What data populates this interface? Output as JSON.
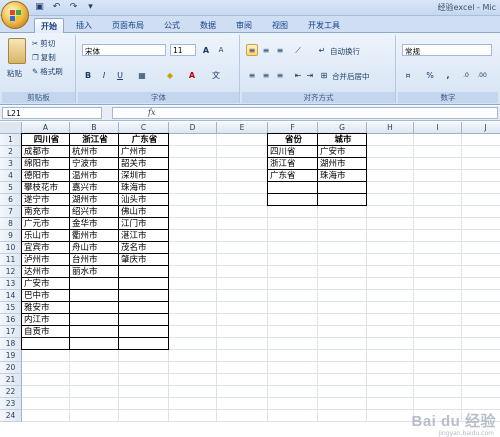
{
  "window": {
    "title": "经验excel - Mic"
  },
  "qat": {
    "icons": [
      "save-icon",
      "undo-icon",
      "redo-icon",
      "customize-icon"
    ],
    "glyphs": [
      "▣",
      "↶",
      "↷",
      "▾"
    ]
  },
  "tabs": [
    "开始",
    "插入",
    "页面布局",
    "公式",
    "数据",
    "审阅",
    "视图",
    "开发工具"
  ],
  "clipboard": {
    "paste": "粘贴",
    "cut": "剪切",
    "copy": "复制",
    "format_painter": "格式刷",
    "label": "剪贴板"
  },
  "font": {
    "name": "宋体",
    "size": "11",
    "grow": "A",
    "shrink": "A",
    "bold": "B",
    "italic": "I",
    "underline": "U",
    "label": "字体"
  },
  "alignment": {
    "wrap": "自动换行",
    "merge": "合并后居中",
    "label": "对齐方式"
  },
  "number": {
    "format": "常规",
    "percent": "%",
    "comma": ",",
    "label": "数字"
  },
  "formula_bar": {
    "name_box": "L21",
    "fx": "fx",
    "formula": ""
  },
  "columns": [
    "A",
    "B",
    "C",
    "D",
    "E",
    "F",
    "G",
    "H",
    "I",
    "J"
  ],
  "rows": [
    "1",
    "2",
    "3",
    "4",
    "5",
    "6",
    "7",
    "8",
    "9",
    "10",
    "11",
    "12",
    "13",
    "14",
    "15",
    "16",
    "17",
    "18",
    "19",
    "20",
    "21",
    "22",
    "23",
    "24"
  ],
  "table1": {
    "headers": [
      "四川省",
      "浙江省",
      "广东省"
    ],
    "rows": [
      [
        "成都市",
        "杭州市",
        "广州市"
      ],
      [
        "绵阳市",
        "宁波市",
        "韶关市"
      ],
      [
        "德阳市",
        "温州市",
        "深圳市"
      ],
      [
        "攀枝花市",
        "嘉兴市",
        "珠海市"
      ],
      [
        "遂宁市",
        "湖州市",
        "汕头市"
      ],
      [
        "南充市",
        "绍兴市",
        "佛山市"
      ],
      [
        "广元市",
        "金华市",
        "江门市"
      ],
      [
        "乐山市",
        "衢州市",
        "湛江市"
      ],
      [
        "宜宾市",
        "舟山市",
        "茂名市"
      ],
      [
        "泸州市",
        "台州市",
        "肇庆市"
      ],
      [
        "达州市",
        "丽水市",
        ""
      ],
      [
        "广安市",
        "",
        ""
      ],
      [
        "巴中市",
        "",
        ""
      ],
      [
        "雅安市",
        "",
        ""
      ],
      [
        "内江市",
        "",
        ""
      ],
      [
        "自贡市",
        "",
        ""
      ],
      [
        "",
        "",
        ""
      ]
    ]
  },
  "table2": {
    "headers": [
      "省份",
      "城市"
    ],
    "rows": [
      [
        "四川省",
        "广安市"
      ],
      [
        "浙江省",
        "湖州市"
      ],
      [
        "广东省",
        "珠海市"
      ],
      [
        "",
        ""
      ],
      [
        "",
        ""
      ]
    ]
  },
  "watermark": {
    "text": "Bai du 经验",
    "sub": "jingyan.baidu.com"
  }
}
